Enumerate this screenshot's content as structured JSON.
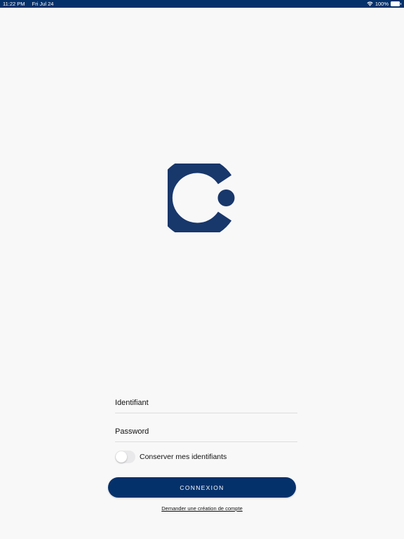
{
  "status_bar": {
    "time": "11:22 PM",
    "date": "Fri Jul 24",
    "battery": "100%",
    "background_color": "#05316b"
  },
  "logo": {
    "icon": "brand-logo-icon",
    "color": "#18376b"
  },
  "login_form": {
    "identifier_placeholder": "Identifiant",
    "identifier_value": "",
    "password_placeholder": "Password",
    "password_value": "",
    "remember_label": "Conserver mes identifiants",
    "remember_checked": false,
    "login_button_label": "CONNEXION",
    "request_account_link": "Demander une création de compte"
  },
  "colors": {
    "primary": "#05316b",
    "background": "#f8f8f8"
  }
}
